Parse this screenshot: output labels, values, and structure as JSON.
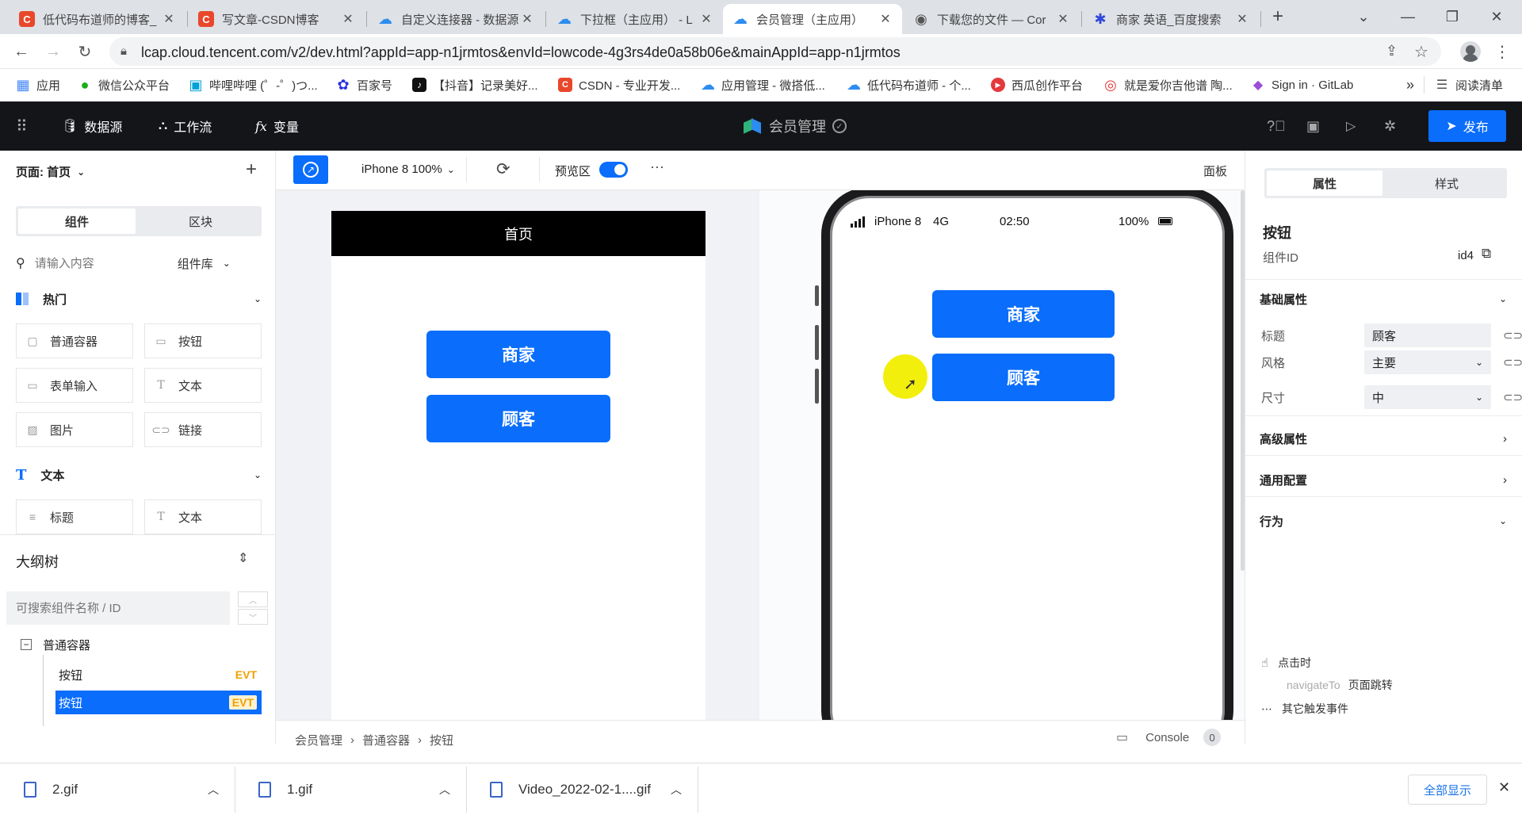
{
  "browser": {
    "tabs": [
      {
        "title": "低代码布道师的博客_",
        "fav": "C",
        "color": "#e8472b"
      },
      {
        "title": "写文章-CSDN博客",
        "fav": "C",
        "color": "#e8472b"
      },
      {
        "title": "自定义连接器 - 数据源",
        "fav": "☁",
        "color": "#2d8cf0"
      },
      {
        "title": "下拉框（主应用） - L",
        "fav": "☁",
        "color": "#2d8cf0"
      },
      {
        "title": "会员管理（主应用）",
        "fav": "☁",
        "color": "#2d8cf0"
      },
      {
        "title": "下载您的文件 — Cor",
        "fav": "◉",
        "color": "#555555"
      },
      {
        "title": "商家 英语_百度搜索",
        "fav": "✱",
        "color": "#3148d8"
      }
    ],
    "new_tab": "+",
    "url": "lcap.cloud.tencent.com/v2/dev.html?appId=app-n1jrmtos&envId=lowcode-4g3rs4de0a58b06e&mainAppId=app-n1jrmtos",
    "bookmarks": [
      {
        "label": "应用",
        "fav": "▦",
        "color": "#4285f4"
      },
      {
        "label": "微信公众平台",
        "fav": "●",
        "color": "#1aad19"
      },
      {
        "label": "哔哩哔哩 (゜-゜)つ...",
        "fav": "▣",
        "color": "#00a1d6"
      },
      {
        "label": "百家号",
        "fav": "✿",
        "color": "#2932e1"
      },
      {
        "label": "【抖音】记录美好...",
        "fav": "♪",
        "color": "#111111"
      },
      {
        "label": "CSDN - 专业开发...",
        "fav": "C",
        "color": "#e8472b"
      },
      {
        "label": "应用管理 - 微搭低...",
        "fav": "☁",
        "color": "#2d8cf0"
      },
      {
        "label": "低代码布道师 - 个...",
        "fav": "☁",
        "color": "#2d8cf0"
      },
      {
        "label": "西瓜创作平台",
        "fav": "▶",
        "color": "#e4393c"
      },
      {
        "label": "就是爱你吉他谱 陶...",
        "fav": "◎",
        "color": "#e4393c"
      },
      {
        "label": "Sign in · GitLab",
        "fav": "◆",
        "color": "#9b4ed6"
      }
    ],
    "bookmarks_more": "»",
    "reading_list": "阅读清单"
  },
  "app": {
    "nav": {
      "datasource": "数据源",
      "workflow": "工作流",
      "variables": "变量"
    },
    "title": "会员管理",
    "publish": "发布",
    "accent": "#0a6dfb"
  },
  "left": {
    "page_label": "页面: 首页",
    "add": "+",
    "tabs": [
      "组件",
      "区块"
    ],
    "search_placeholder": "请输入内容",
    "library": "组件库",
    "hot": {
      "title": "热门",
      "items": [
        "普通容器",
        "按钮",
        "表单输入",
        "文本",
        "图片",
        "链接"
      ]
    },
    "text": {
      "title": "文本",
      "items": [
        "标题",
        "文本"
      ]
    },
    "outline": {
      "title": "大纲树",
      "search_placeholder": "可搜索组件名称 / ID",
      "root": "普通容器",
      "children": [
        {
          "label": "按钮",
          "badge": "EVT"
        },
        {
          "label": "按钮",
          "badge": "EVT"
        }
      ]
    }
  },
  "toolbar": {
    "device": "iPhone 8 100%",
    "preview": "预览区",
    "more": "···",
    "panel": "面板"
  },
  "canvas": {
    "page_title": "首页",
    "buttons": [
      "商家",
      "顾客"
    ],
    "status": {
      "carrier": "iPhone 8",
      "network": "4G",
      "time": "02:50",
      "battery": "100%"
    }
  },
  "breadcrumb": {
    "items": [
      "会员管理",
      "普通容器",
      "按钮"
    ],
    "console": "Console",
    "console_count": "0"
  },
  "right": {
    "tabs": [
      "属性",
      "样式"
    ],
    "component": "按钮",
    "id_label": "组件ID",
    "id_value": "id4",
    "basic": "基础属性",
    "props": [
      {
        "label": "标题",
        "value": "顾客"
      },
      {
        "label": "风格",
        "value": "主要"
      },
      {
        "label": "尺寸",
        "value": "中"
      }
    ],
    "advanced": "高级属性",
    "general": "通用配置",
    "behavior": "行为",
    "on_click": "点击时",
    "action_key": "navigateTo",
    "action_value": "页面跳转",
    "other_events": "其它触发事件"
  },
  "downloads": {
    "items": [
      "2.gif",
      "1.gif",
      "Video_2022-02-1....gif"
    ],
    "show_all": "全部显示",
    "close": "✕"
  }
}
